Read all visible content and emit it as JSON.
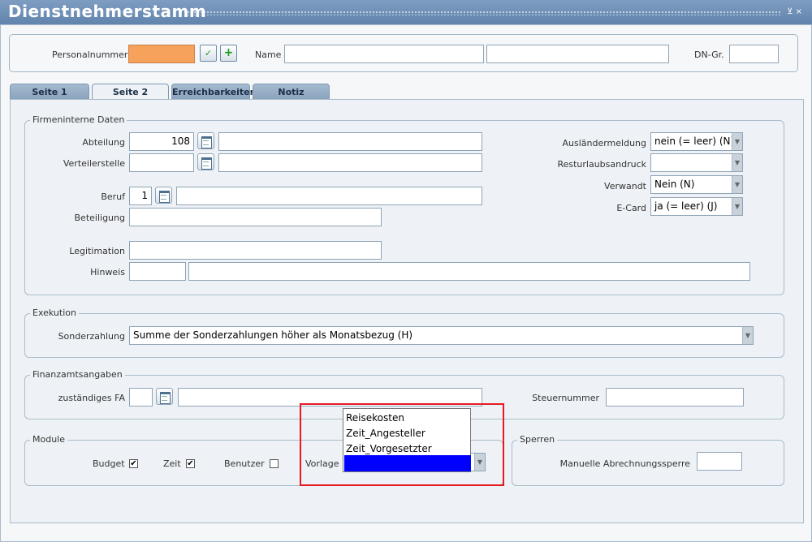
{
  "window": {
    "title": "Dienstnehmerstamm",
    "controls": "⊻ ×"
  },
  "header": {
    "personalnummer_label": "Personalnummer",
    "personalnummer_value": "",
    "name_label": "Name",
    "name_value_1": "",
    "name_value_2": "",
    "dngr_label": "DN-Gr.",
    "dngr_value": "",
    "accent_color": "#f6a25b"
  },
  "tabs": [
    {
      "label": "Seite 1"
    },
    {
      "label": "Seite 2"
    },
    {
      "label": "Erreichbarkeiten"
    },
    {
      "label": "Notiz"
    }
  ],
  "firmeninterne": {
    "title": "Firmeninterne Daten",
    "abteilung_label": "Abteilung",
    "abteilung_value": "108",
    "abteilung_text": "",
    "verteilerstelle_label": "Verteilerstelle",
    "verteilerstelle_value": "",
    "verteilerstelle_text": "",
    "beruf_label": "Beruf",
    "beruf_value": "1",
    "beruf_text": "",
    "beteiligung_label": "Beteiligung",
    "beteiligung_value": "",
    "legitimation_label": "Legitimation",
    "legitimation_value": "",
    "hinweis_label": "Hinweis",
    "hinweis_value_1": "",
    "hinweis_value_2": "",
    "auslaender_label": "Ausländermeldung",
    "auslaender_value": "nein (= leer) (N)",
    "resturlaub_label": "Resturlaubsandruck",
    "resturlaub_value": "",
    "verwandt_label": "Verwandt",
    "verwandt_value": "Nein (N)",
    "ecard_label": "E-Card",
    "ecard_value": "ja (= leer) (J)"
  },
  "exekution": {
    "title": "Exekution",
    "sonderzahlung_label": "Sonderzahlung",
    "sonderzahlung_value": "Summe der Sonderzahlungen höher als Monatsbezug (H)"
  },
  "finanzamt": {
    "title": "Finanzamtsangaben",
    "fa_label": "zuständiges FA",
    "fa_value": "",
    "fa_text": "",
    "steuernummer_label": "Steuernummer",
    "steuernummer_value": ""
  },
  "module": {
    "title": "Module",
    "budget_label": "Budget",
    "budget_checked": "✔",
    "zeit_label": "Zeit",
    "zeit_checked": "✔",
    "benutzer_label": "Benutzer",
    "benutzer_checked": "",
    "vorlage_label": "Vorlage",
    "vorlage_options": [
      "Reisekosten",
      "Zeit_Angesteller",
      "Zeit_Vorgesetzter",
      ""
    ],
    "selected_color": "#0000ff"
  },
  "sperren": {
    "title": "Sperren",
    "abrechnungssperre_label": "Manuelle Abrechnungssperre",
    "abrechnungssperre_value": ""
  }
}
